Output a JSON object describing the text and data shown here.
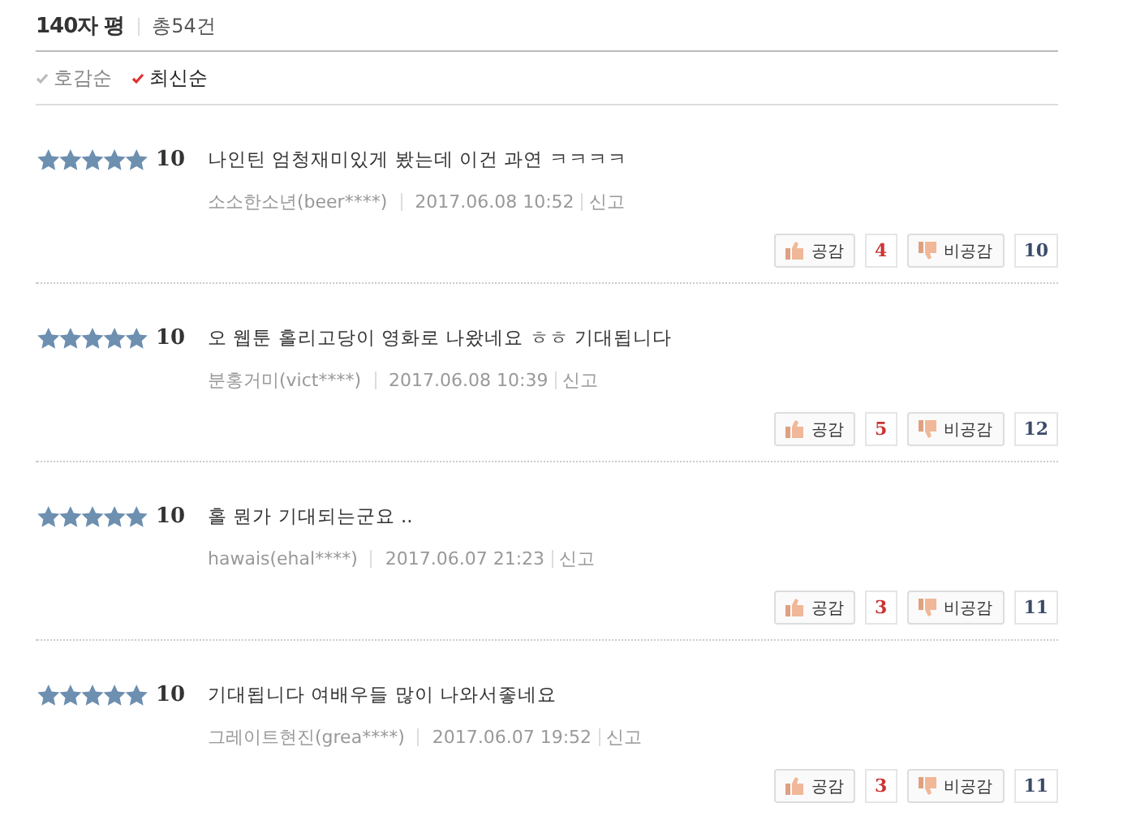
{
  "header": {
    "title": "140자 평",
    "total": "총54건"
  },
  "sort_options": [
    {
      "label": "호감순",
      "selected": false
    },
    {
      "label": "최신순",
      "selected": true
    }
  ],
  "reviews": [
    {
      "stars": 5,
      "score": "10",
      "text": "나인틴 엄청재미있게 봤는데 이건 과연 ㅋㅋㅋㅋ",
      "author": "소소한소년(beer****)",
      "date": "2017.06.08 10:52",
      "report": "신고",
      "like_label": "공감",
      "likes": "4",
      "dislike_label": "비공감",
      "dislikes": "10"
    },
    {
      "stars": 5,
      "score": "10",
      "text": "오 웹툰 홀리고당이 영화로 나왔네요 ㅎㅎ 기대됩니다",
      "author": "분홍거미(vict****)",
      "date": "2017.06.08 10:39",
      "report": "신고",
      "like_label": "공감",
      "likes": "5",
      "dislike_label": "비공감",
      "dislikes": "12"
    },
    {
      "stars": 5,
      "score": "10",
      "text": "홀 뭔가 기대되는군요 ..",
      "author": "hawais(ehal****)",
      "date": "2017.06.07 21:23",
      "report": "신고",
      "like_label": "공감",
      "likes": "3",
      "dislike_label": "비공감",
      "dislikes": "11"
    },
    {
      "stars": 5,
      "score": "10",
      "text": "기대됩니다 여배우들 많이 나와서좋네요",
      "author": "그레이트현진(grea****)",
      "date": "2017.06.07 19:52",
      "report": "신고",
      "like_label": "공감",
      "likes": "3",
      "dislike_label": "비공감",
      "dislikes": "11"
    }
  ]
}
